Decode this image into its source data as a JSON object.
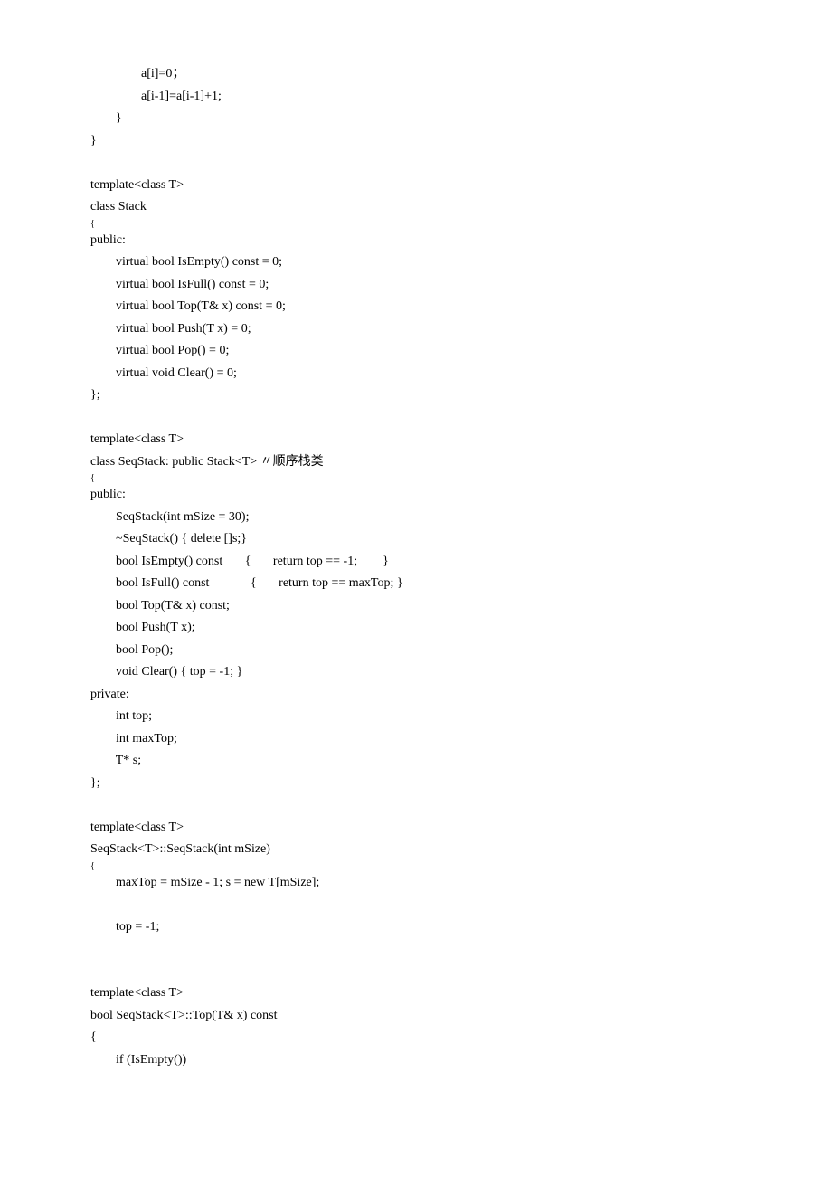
{
  "lines": [
    {
      "text": "                a[i]=0；"
    },
    {
      "text": "                a[i-1]=a[i-1]+1;"
    },
    {
      "text": "        }"
    },
    {
      "text": "}"
    },
    {
      "text": ""
    },
    {
      "text": "template<class T>"
    },
    {
      "text": "class Stack"
    },
    {
      "text": "{",
      "small": true
    },
    {
      "text": "public:"
    },
    {
      "text": "        virtual bool IsEmpty() const = 0;"
    },
    {
      "text": "        virtual bool IsFull() const = 0;"
    },
    {
      "text": "        virtual bool Top(T& x) const = 0;"
    },
    {
      "text": "        virtual bool Push(T x) = 0;"
    },
    {
      "text": "        virtual bool Pop() = 0;"
    },
    {
      "text": "        virtual void Clear() = 0;"
    },
    {
      "text": "};"
    },
    {
      "text": ""
    },
    {
      "text": "template<class T>"
    },
    {
      "text": "class SeqStack: public Stack<T> 〃顺序栈类"
    },
    {
      "text": "{",
      "small": true
    },
    {
      "text": "public:"
    },
    {
      "text": "        SeqStack(int mSize = 30);"
    },
    {
      "text": "        ~SeqStack() { delete []s;}"
    },
    {
      "text": "        bool IsEmpty() const       {       return top == -1;        }"
    },
    {
      "text": "        bool IsFull() const             {       return top == maxTop; }"
    },
    {
      "text": "        bool Top(T& x) const;"
    },
    {
      "text": "        bool Push(T x);"
    },
    {
      "text": "        bool Pop();"
    },
    {
      "text": "        void Clear() { top = -1; }"
    },
    {
      "text": "private:"
    },
    {
      "text": "        int top;"
    },
    {
      "text": "        int maxTop;"
    },
    {
      "text": "        T* s;"
    },
    {
      "text": "};"
    },
    {
      "text": ""
    },
    {
      "text": "template<class T>"
    },
    {
      "text": "SeqStack<T>::SeqStack(int mSize)"
    },
    {
      "text": "{",
      "small": true
    },
    {
      "text": "        maxTop = mSize - 1; s = new T[mSize];"
    },
    {
      "text": ""
    },
    {
      "text": "        top = -1;"
    },
    {
      "text": ""
    },
    {
      "text": ""
    },
    {
      "text": "template<class T>"
    },
    {
      "text": "bool SeqStack<T>::Top(T& x) const"
    },
    {
      "text": "{"
    },
    {
      "text": "        if (IsEmpty())"
    }
  ]
}
